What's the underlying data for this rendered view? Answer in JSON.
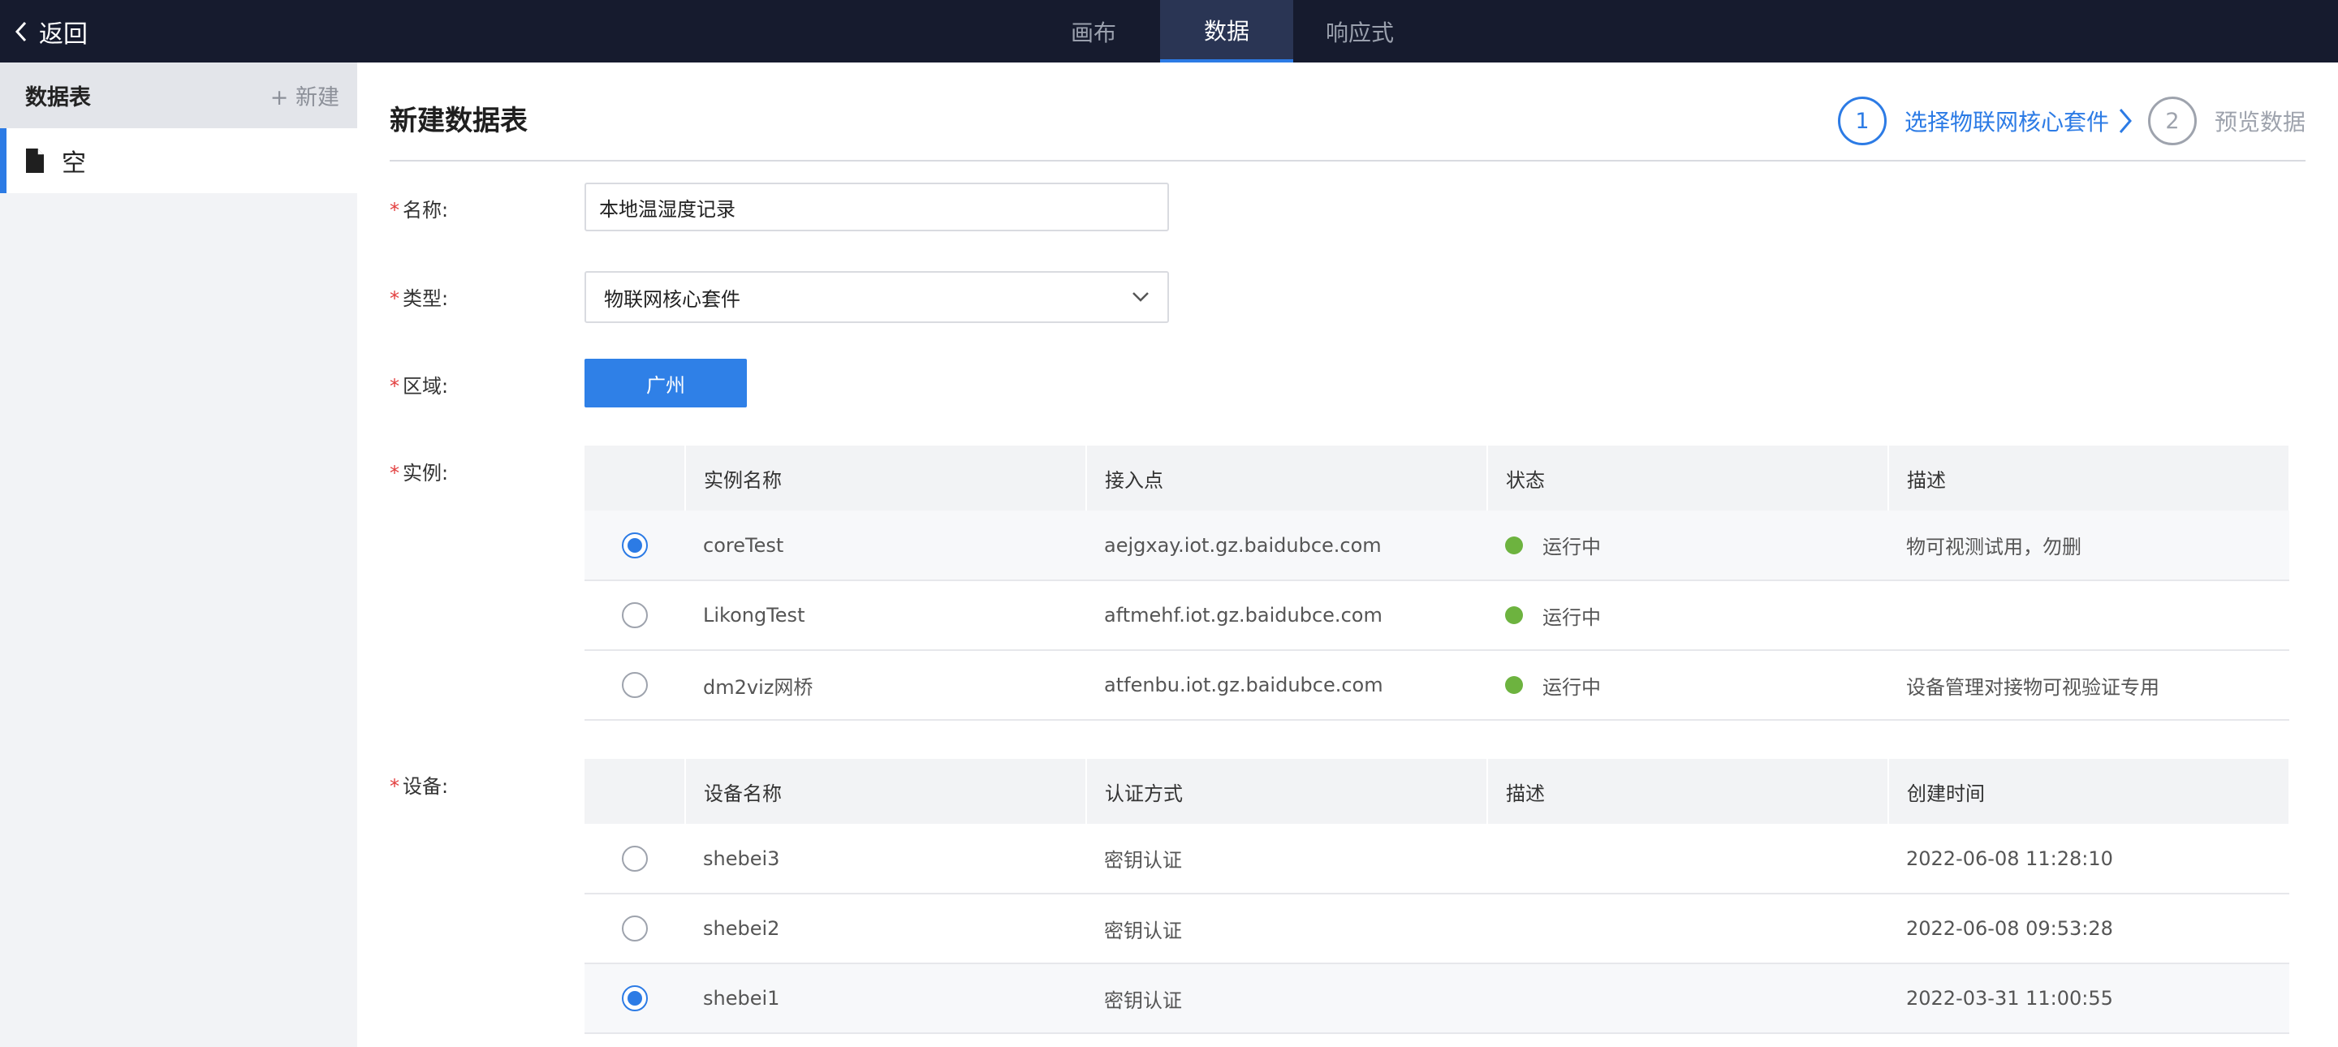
{
  "topbar": {
    "back_label": "返回",
    "tabs": [
      {
        "label": "画布"
      },
      {
        "label": "数据"
      },
      {
        "label": "响应式"
      }
    ]
  },
  "sidebar": {
    "title": "数据表",
    "new_label": "+ 新建",
    "items": [
      {
        "label": "空",
        "icon": "document-icon"
      }
    ]
  },
  "main": {
    "title": "新建数据表",
    "steps": [
      {
        "number": "1",
        "label": "选择物联网核心套件",
        "state": "active"
      },
      {
        "number": "2",
        "label": "预览数据",
        "state": "idle"
      }
    ],
    "form": {
      "name_label": "名称:",
      "name_value": "本地温湿度记录",
      "type_label": "类型:",
      "type_value": "物联网核心套件",
      "region_label": "区域:",
      "region_value": "广州",
      "instance_label": "实例:",
      "device_label": "设备:"
    },
    "instances": {
      "columns": [
        "",
        "实例名称",
        "接入点",
        "状态",
        "描述"
      ],
      "rows": [
        {
          "selected": true,
          "name": "coreTest",
          "endpoint": "aejgxay.iot.gz.baidubce.com",
          "status": "运行中",
          "desc": "物可视测试用，勿删"
        },
        {
          "selected": false,
          "name": "LikongTest",
          "endpoint": "aftmehf.iot.gz.baidubce.com",
          "status": "运行中",
          "desc": ""
        },
        {
          "selected": false,
          "name": "dm2viz网桥",
          "endpoint": "atfenbu.iot.gz.baidubce.com",
          "status": "运行中",
          "desc": "设备管理对接物可视验证专用"
        }
      ]
    },
    "devices": {
      "columns": [
        "",
        "设备名称",
        "认证方式",
        "描述",
        "创建时间"
      ],
      "rows": [
        {
          "selected": false,
          "name": "shebei3",
          "auth": "密钥认证",
          "desc": "",
          "created": "2022-06-08 11:28:10"
        },
        {
          "selected": false,
          "name": "shebei2",
          "auth": "密钥认证",
          "desc": "",
          "created": "2022-06-08 09:53:28"
        },
        {
          "selected": true,
          "name": "shebei1",
          "auth": "密钥认证",
          "desc": "",
          "created": "2022-03-31 11:00:55"
        }
      ]
    }
  },
  "colors": {
    "accent": "#2c7be5",
    "topbar_bg": "#161b2e",
    "status_running": "#6db33f",
    "required": "#e23e3e"
  }
}
